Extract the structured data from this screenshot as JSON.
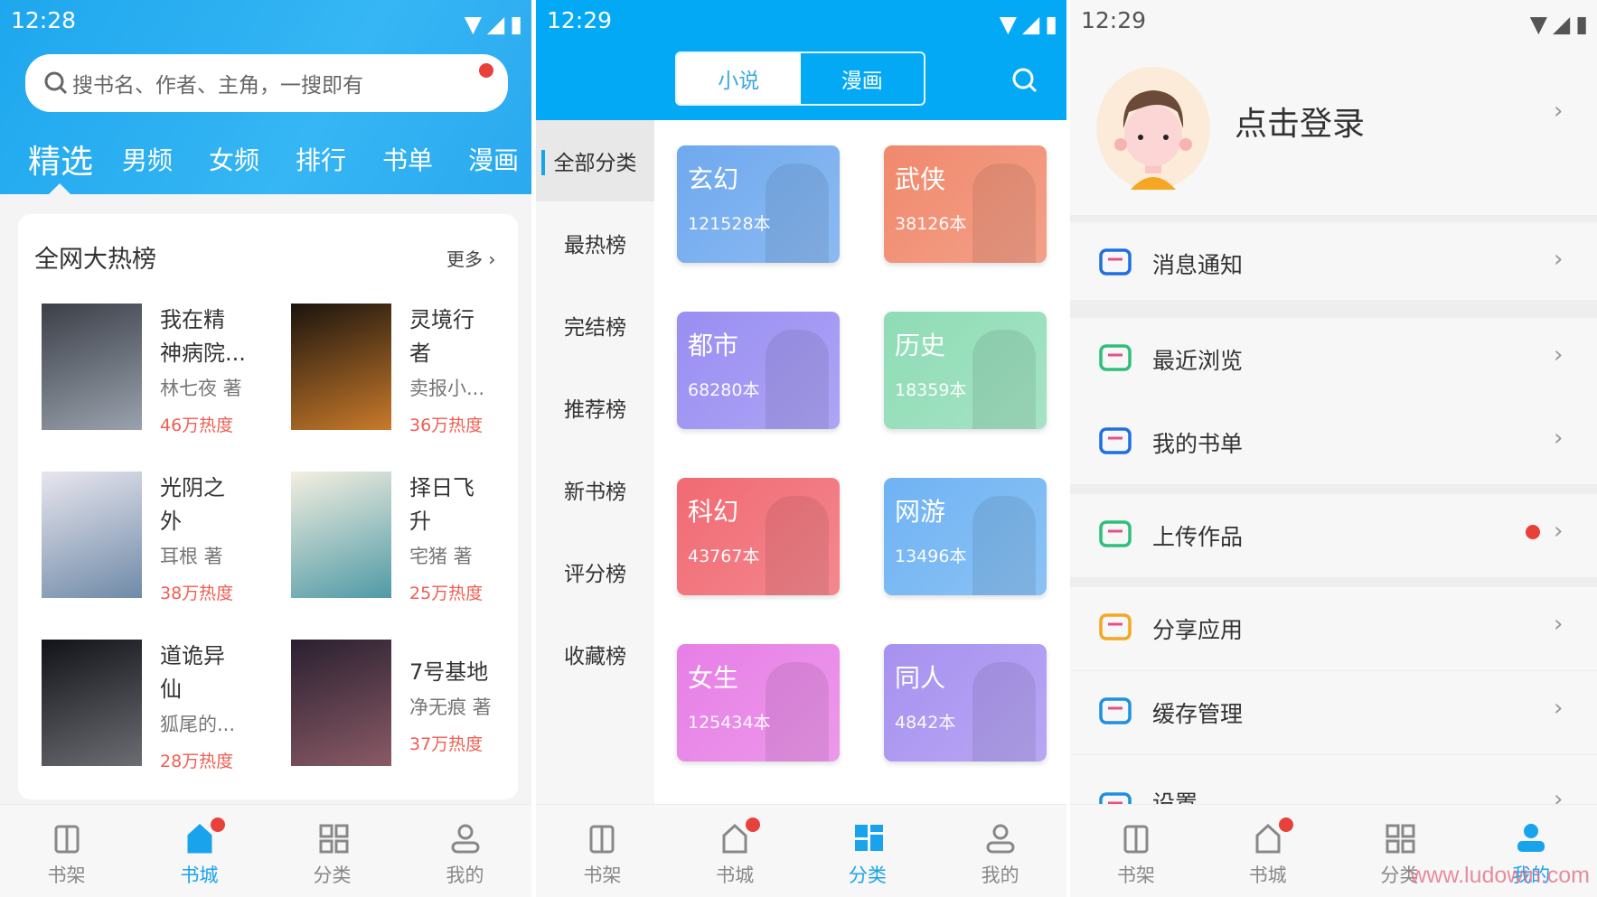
{
  "colors": {
    "accent": "#19a3ec",
    "hot": "#ef5e52",
    "badge": "#e8413b"
  },
  "bookstore": {
    "time": "12:28",
    "search_placeholder": "搜书名、作者、主角，一搜即有",
    "tabs": [
      "精选",
      "男频",
      "女频",
      "排行",
      "书单",
      "漫画"
    ],
    "section_title": "全网大热榜",
    "more": "更多",
    "books": [
      {
        "title1": "我在精",
        "title2": "神病院...",
        "author": "林七夜 著",
        "heat": "46万热度",
        "cover": [
          "#3b3f48",
          "#9aa2ad"
        ]
      },
      {
        "title1": "灵境行",
        "title2": "者",
        "author": "卖报小...",
        "heat": "36万热度",
        "cover": [
          "#1a140e",
          "#c97a2a"
        ]
      },
      {
        "title1": "光阴之",
        "title2": "外",
        "author": "耳根 著",
        "heat": "38万热度",
        "cover": [
          "#e8e6ee",
          "#6f8aa8"
        ]
      },
      {
        "title1": "择日飞",
        "title2": "升",
        "author": "宅猪 著",
        "heat": "25万热度",
        "cover": [
          "#f4efe0",
          "#4f9aa6"
        ]
      },
      {
        "title1": "道诡异",
        "title2": "仙",
        "author": "狐尾的...",
        "heat": "28万热度",
        "cover": [
          "#111318",
          "#6b6d72"
        ]
      },
      {
        "title1": "7号基地",
        "title2": "",
        "author": "净无痕 著",
        "heat": "37万热度",
        "cover": [
          "#2a2030",
          "#8a5a66"
        ]
      }
    ]
  },
  "category": {
    "time": "12:29",
    "segments": [
      "小说",
      "漫画"
    ],
    "sidebar": [
      "全部分类",
      "最热榜",
      "完结榜",
      "推荐榜",
      "新书榜",
      "评分榜",
      "收藏榜"
    ],
    "cards": [
      {
        "name": "玄幻",
        "count": "121528本",
        "color": "#6fa9ee"
      },
      {
        "name": "武侠",
        "count": "38126本",
        "color": "#f0896c"
      },
      {
        "name": "都市",
        "count": "68280本",
        "color": "#998ef2"
      },
      {
        "name": "历史",
        "count": "18359本",
        "color": "#8fdcb6"
      },
      {
        "name": "科幻",
        "count": "43767本",
        "color": "#f16a73"
      },
      {
        "name": "网游",
        "count": "13496本",
        "color": "#6fb3f3"
      },
      {
        "name": "女生",
        "count": "125434本",
        "color": "#e77fe6"
      },
      {
        "name": "同人",
        "count": "4842本",
        "color": "#a791f0"
      }
    ]
  },
  "mine": {
    "time": "12:29",
    "login": "点击登录",
    "menu": [
      {
        "label": "消息通知",
        "icon": "message-icon",
        "color": "#1f6fe0"
      },
      {
        "label": "最近浏览",
        "icon": "clock-icon",
        "color": "#2fbf7a"
      },
      {
        "label": "我的书单",
        "icon": "booklist-icon",
        "color": "#1f6fe0"
      },
      {
        "label": "上传作品",
        "icon": "upload-icon",
        "color": "#2fbf7a",
        "badge": true
      },
      {
        "label": "分享应用",
        "icon": "share-icon",
        "color": "#f5a623"
      },
      {
        "label": "缓存管理",
        "icon": "cloud-download-icon",
        "color": "#1f8fe0"
      },
      {
        "label": "设置",
        "icon": "settings-icon",
        "color": "#1f8fe0"
      }
    ],
    "watermark": "www.ludowin.com"
  },
  "nav": [
    "书架",
    "书城",
    "分类",
    "我的"
  ]
}
